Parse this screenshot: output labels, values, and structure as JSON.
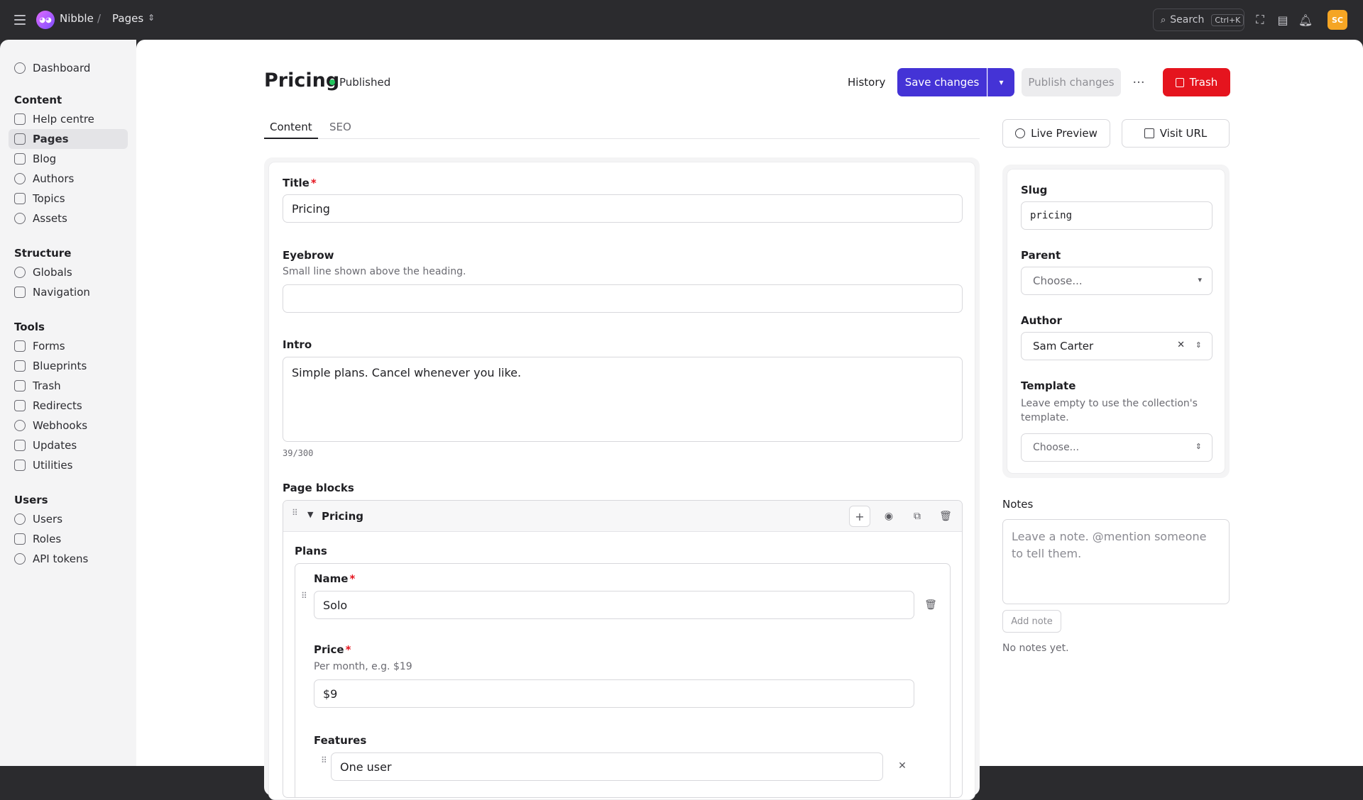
{
  "topbar": {
    "brand": "Nibble",
    "crumb_sep": "/",
    "crumb": "Pages",
    "search_label": "Search",
    "search_shortcut": "Ctrl+K",
    "avatar_initials": "SC"
  },
  "sidebar": {
    "dashboard": "Dashboard",
    "sections": {
      "content": "Content",
      "structure": "Structure",
      "tools": "Tools",
      "users": "Users"
    },
    "content_items": [
      "Help centre",
      "Pages",
      "Blog",
      "Authors",
      "Topics",
      "Assets"
    ],
    "structure_items": [
      "Globals",
      "Navigation"
    ],
    "tools_items": [
      "Forms",
      "Blueprints",
      "Trash",
      "Redirects",
      "Webhooks",
      "Updates",
      "Utilities"
    ],
    "users_items": [
      "Users",
      "Roles",
      "API tokens"
    ]
  },
  "header": {
    "title": "Pricing",
    "status": "Published",
    "history": "History",
    "save": "Save changes",
    "publish": "Publish changes",
    "more": "···",
    "trash": "Trash"
  },
  "tabs": [
    "Content",
    "SEO"
  ],
  "form": {
    "title_label": "Title",
    "title_value": "Pricing",
    "eyebrow_label": "Eyebrow",
    "eyebrow_help": "Small line shown above the heading.",
    "eyebrow_value": "",
    "intro_label": "Intro",
    "intro_value": "Simple plans. Cancel whenever you like.",
    "intro_counter": "39/300",
    "blocks_label": "Page blocks",
    "block_title": "Pricing",
    "plans_label": "Plans",
    "plan": {
      "name_label": "Name",
      "name_value": "Solo",
      "price_label": "Price",
      "price_help": "Per month, e.g. $19",
      "price_value": "$9",
      "features_label": "Features",
      "feature_1": "One user"
    }
  },
  "side": {
    "live_preview": "Live Preview",
    "visit_url": "Visit URL",
    "slug_label": "Slug",
    "slug_value": "pricing",
    "parent_label": "Parent",
    "parent_placeholder": "Choose...",
    "author_label": "Author",
    "author_value": "Sam Carter",
    "template_label": "Template",
    "template_help": "Leave empty to use the collection's template.",
    "template_placeholder": "Choose...",
    "notes_label": "Notes",
    "notes_placeholder": "Leave a note. @mention someone to tell them.",
    "add_note": "Add note",
    "no_notes": "No notes yet."
  },
  "colors": {
    "primary": "#4433d6",
    "danger": "#e5141e",
    "published": "#22c55e",
    "avatar": "#f5a524"
  }
}
